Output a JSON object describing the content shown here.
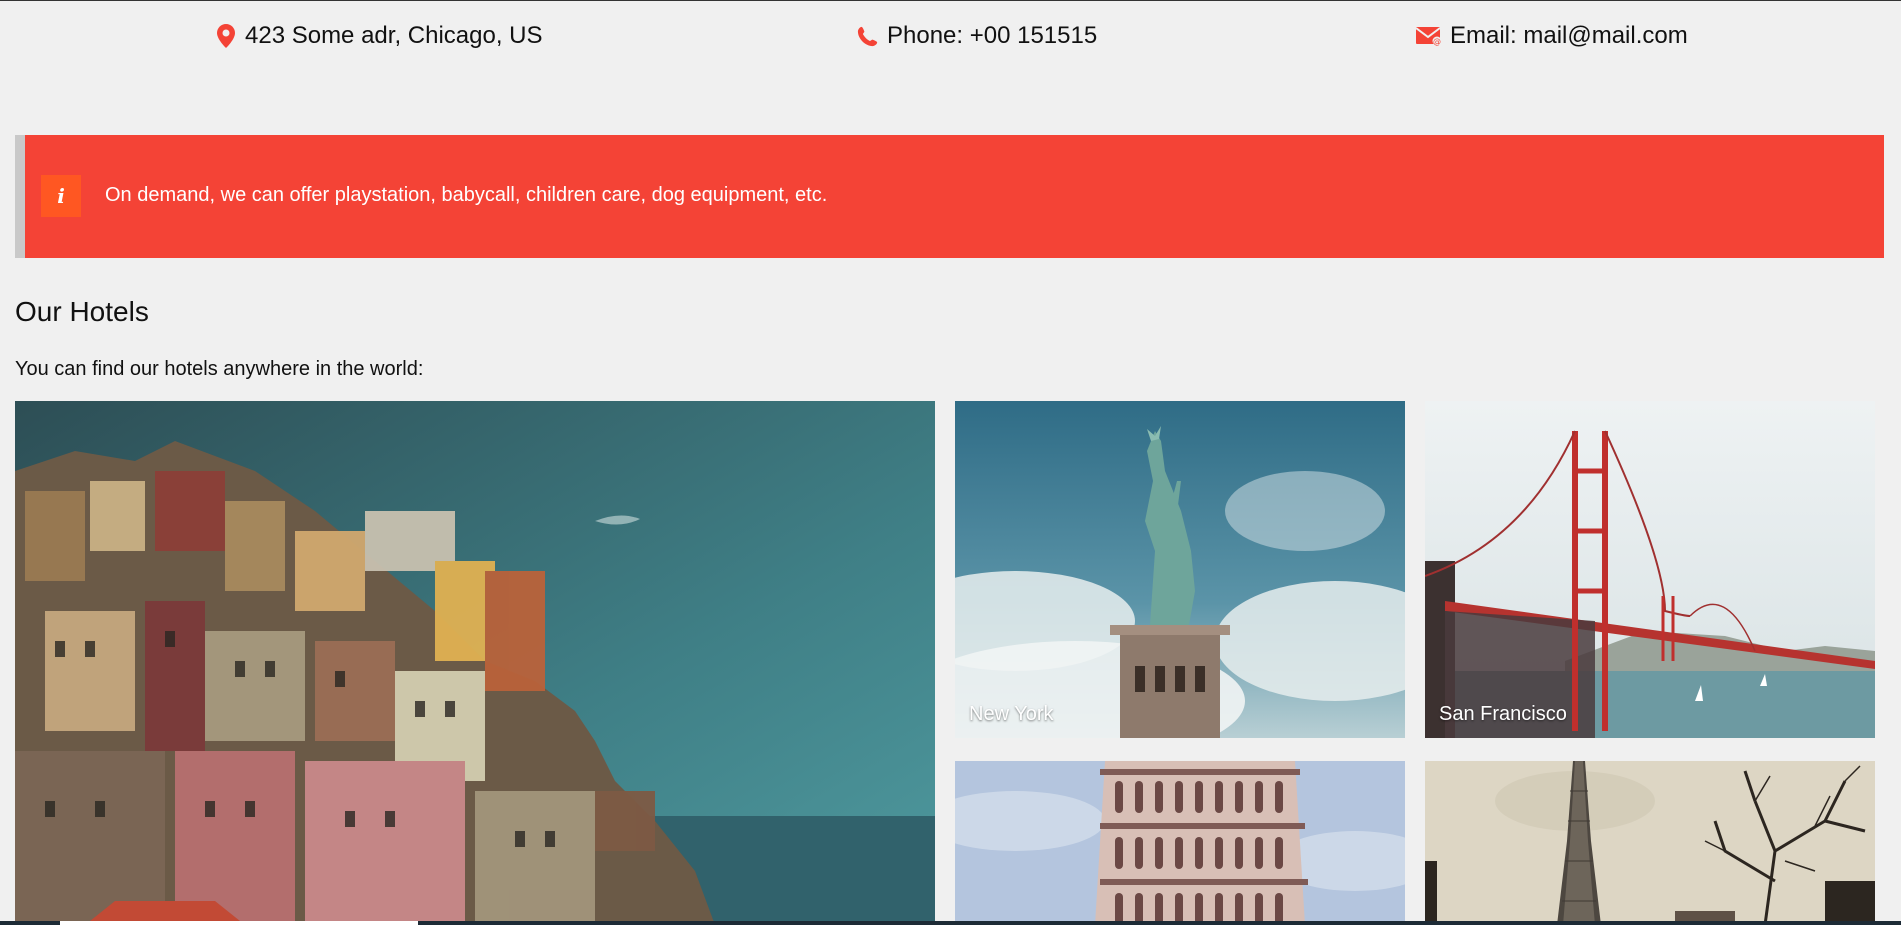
{
  "contact": {
    "address": "423 Some adr, Chicago, US",
    "phone": "Phone: +00 151515",
    "email": "Email: mail@mail.com",
    "icons": [
      "map-marker-icon",
      "phone-icon",
      "envelope-icon"
    ],
    "icon_color": "#f44336"
  },
  "alert": {
    "icon_glyph": "i",
    "message": "On demand, we can offer playstation, babycall, children care, dog equipment, etc.",
    "background": "#f44336",
    "icon_background": "#ff5722"
  },
  "hotels": {
    "title": "Our Hotels",
    "subtitle": "You can find our hotels anywhere in the world:",
    "cities": [
      {
        "name": ""
      },
      {
        "name": "New York"
      },
      {
        "name": "San Francisco"
      },
      {
        "name": ""
      },
      {
        "name": ""
      }
    ]
  }
}
